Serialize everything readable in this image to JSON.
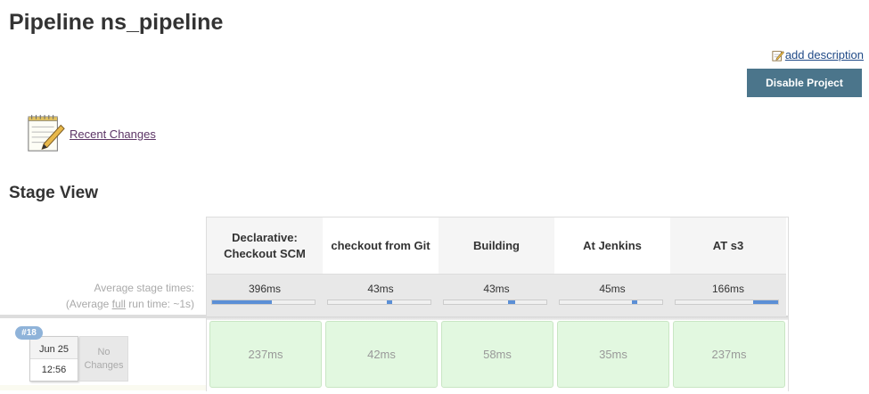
{
  "page": {
    "title": "Pipeline ns_pipeline",
    "add_description": "add description",
    "disable_button": "Disable Project",
    "recent_changes": "Recent Changes"
  },
  "stage_view": {
    "title": "Stage View",
    "avg_label_line1": "Average stage times:",
    "avg_label_line2_prefix": "(Average ",
    "avg_label_line2_full": "full",
    "avg_label_line2_suffix": " run time: ~1s)",
    "stages": [
      {
        "name": "Declarative: Checkout SCM",
        "avg": "396ms",
        "bar_start": 0,
        "bar_end": 0.58,
        "cell": "237ms"
      },
      {
        "name": "checkout from Git",
        "avg": "43ms",
        "bar_start": 0.57,
        "bar_end": 0.63,
        "cell": "42ms"
      },
      {
        "name": "Building",
        "avg": "43ms",
        "bar_start": 0.63,
        "bar_end": 0.7,
        "cell": "58ms"
      },
      {
        "name": "At Jenkins",
        "avg": "45ms",
        "bar_start": 0.7,
        "bar_end": 0.76,
        "cell": "35ms"
      },
      {
        "name": "AT s3",
        "avg": "166ms",
        "bar_start": 0.76,
        "bar_end": 1.0,
        "cell": "237ms"
      }
    ],
    "build": {
      "number": "#18",
      "date": "Jun 25",
      "time": "12:56",
      "changes": "No Changes"
    }
  },
  "colors": {
    "accent_button": "#4b758b",
    "success_cell": "#e2f8e0",
    "progress_bar": "#5b8fd6",
    "badge": "#8fb3d9"
  },
  "icons": [
    "edit-icon",
    "notepad-icon"
  ]
}
